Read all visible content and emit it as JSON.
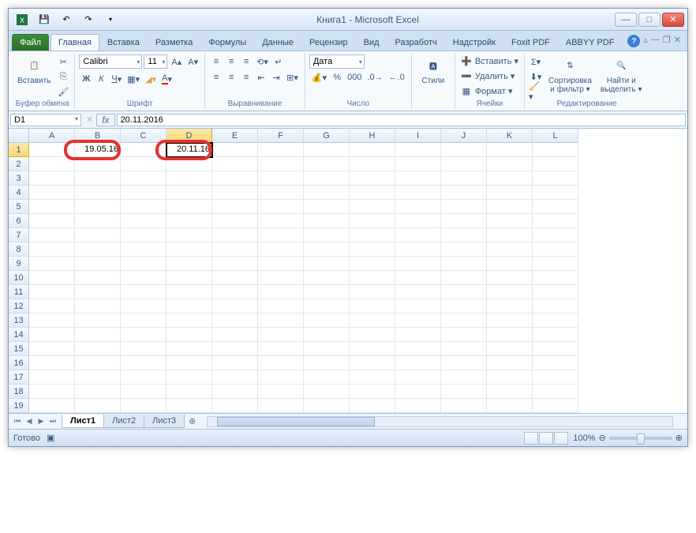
{
  "titlebar": {
    "title": "Книга1  -  Microsoft Excel"
  },
  "tabs": {
    "file": "Файл",
    "items": [
      "Главная",
      "Вставка",
      "Разметка",
      "Формулы",
      "Данные",
      "Рецензир",
      "Вид",
      "Разработч",
      "Надстройк",
      "Foxit PDF",
      "ABBYY PDF"
    ],
    "active": 0
  },
  "ribbon": {
    "clipboard": {
      "paste": "Вставить",
      "label": "Буфер обмена"
    },
    "font": {
      "name": "Calibri",
      "size": "11",
      "label": "Шрифт"
    },
    "align": {
      "label": "Выравнивание"
    },
    "number": {
      "format": "Дата",
      "label": "Число"
    },
    "styles": {
      "btn": "Стили"
    },
    "cells": {
      "insert": "Вставить ▾",
      "delete": "Удалить ▾",
      "format": "Формат ▾",
      "label": "Ячейки"
    },
    "editing": {
      "sort": "Сортировка\nи фильтр ▾",
      "find": "Найти и\nвыделить ▾",
      "label": "Редактирование"
    }
  },
  "formula": {
    "name": "D1",
    "value": "20.11.2016"
  },
  "grid": {
    "cols": [
      "A",
      "B",
      "C",
      "D",
      "E",
      "F",
      "G",
      "H",
      "I",
      "J",
      "K",
      "L"
    ],
    "active_col": 3,
    "active_row": 0,
    "rows": 19,
    "cells": {
      "B1": "19.05.16",
      "D1": "20.11.16"
    }
  },
  "sheets": {
    "items": [
      "Лист1",
      "Лист2",
      "Лист3"
    ],
    "active": 0
  },
  "status": {
    "ready": "Готово",
    "zoom": "100%"
  }
}
